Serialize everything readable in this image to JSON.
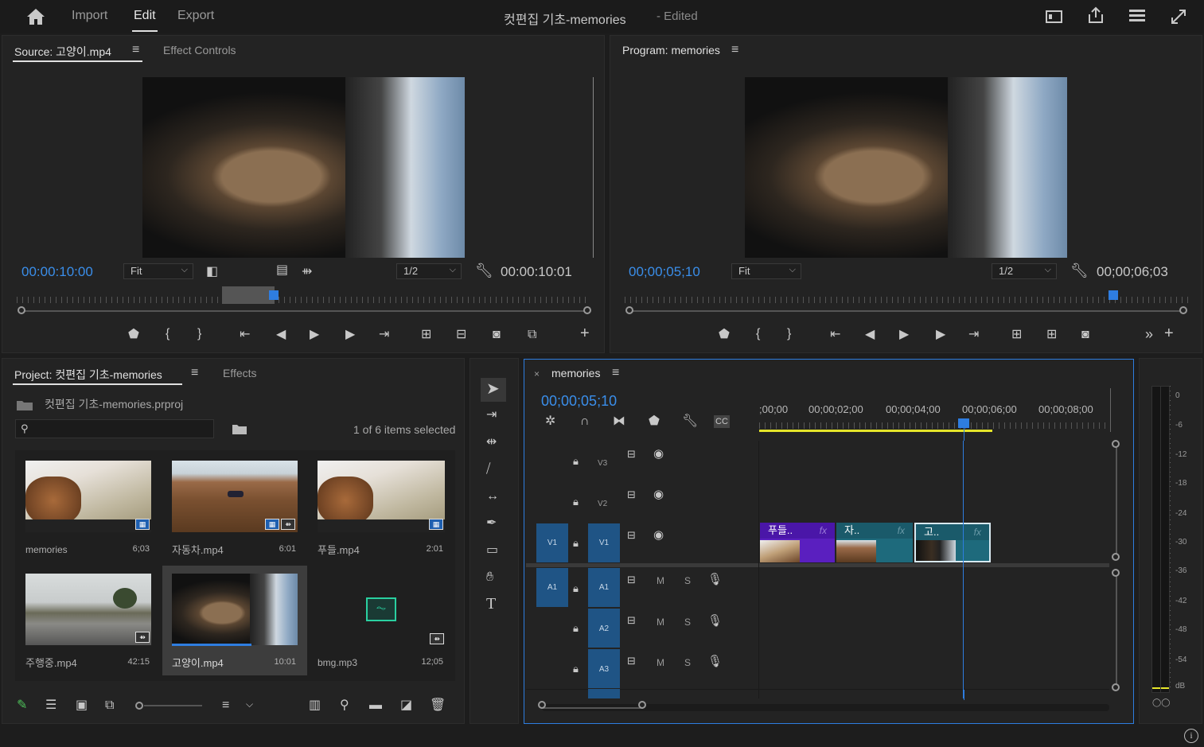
{
  "header": {
    "nav": [
      "Import",
      "Edit",
      "Export"
    ],
    "title": "컷편집 기초-memories",
    "title_status": "- Edited"
  },
  "source": {
    "tab_label": "Source: 고양이.mp4",
    "tab2_label": "Effect Controls",
    "timecode_in": "00:00:10:00",
    "fit": "Fit",
    "resolution": "1/2",
    "timecode_dur": "00:00:10:01"
  },
  "program": {
    "tab_label": "Program: memories",
    "timecode_in": "00;00;05;10",
    "fit": "Fit",
    "resolution": "1/2",
    "timecode_dur": "00;00;06;03"
  },
  "project": {
    "tab_label": "Project: 컷편집 기초-memories",
    "tab2_label": "Effects",
    "file": "컷편집 기초-memories.prproj",
    "search_placeholder": "",
    "selection": "1 of 6 items selected",
    "items": [
      {
        "name": "memories",
        "dur": "6;03"
      },
      {
        "name": "자동차.mp4",
        "dur": "6:01"
      },
      {
        "name": "푸들.mp4",
        "dur": "2:01"
      },
      {
        "name": "주행중.mp4",
        "dur": "42:15"
      },
      {
        "name": "고양이.mp4",
        "dur": "10:01"
      },
      {
        "name": "bmg.mp3",
        "dur": "12;05"
      }
    ]
  },
  "timeline": {
    "tab_label": "memories",
    "timecode": "00;00;05;10",
    "ruler": [
      ";00;00",
      "00;00;02;00",
      "00;00;04;00",
      "00;00;06;00",
      "00;00;08;00"
    ],
    "tracks": {
      "v3": "V3",
      "v2": "V2",
      "v1": "V1",
      "v1_src": "V1",
      "a1": "A1",
      "a1_src": "A1",
      "a2": "A2",
      "a3": "A3",
      "m": "M",
      "s": "S"
    },
    "clips": [
      {
        "label": "푸들..",
        "fx": "fx"
      },
      {
        "label": "자..",
        "fx": "fx"
      },
      {
        "label": "고..",
        "fx": "fx"
      }
    ]
  },
  "meter": {
    "ticks": [
      "0",
      "-6",
      "-12",
      "-18",
      "-24",
      "-30",
      "-36",
      "-42",
      "-48",
      "-54",
      "dB"
    ],
    "solo": "S",
    "s_label": "S"
  },
  "colors": {
    "accent": "#3a8eea",
    "clip_purple": "#5a1fbf",
    "clip_teal": "#1e6a7c"
  }
}
